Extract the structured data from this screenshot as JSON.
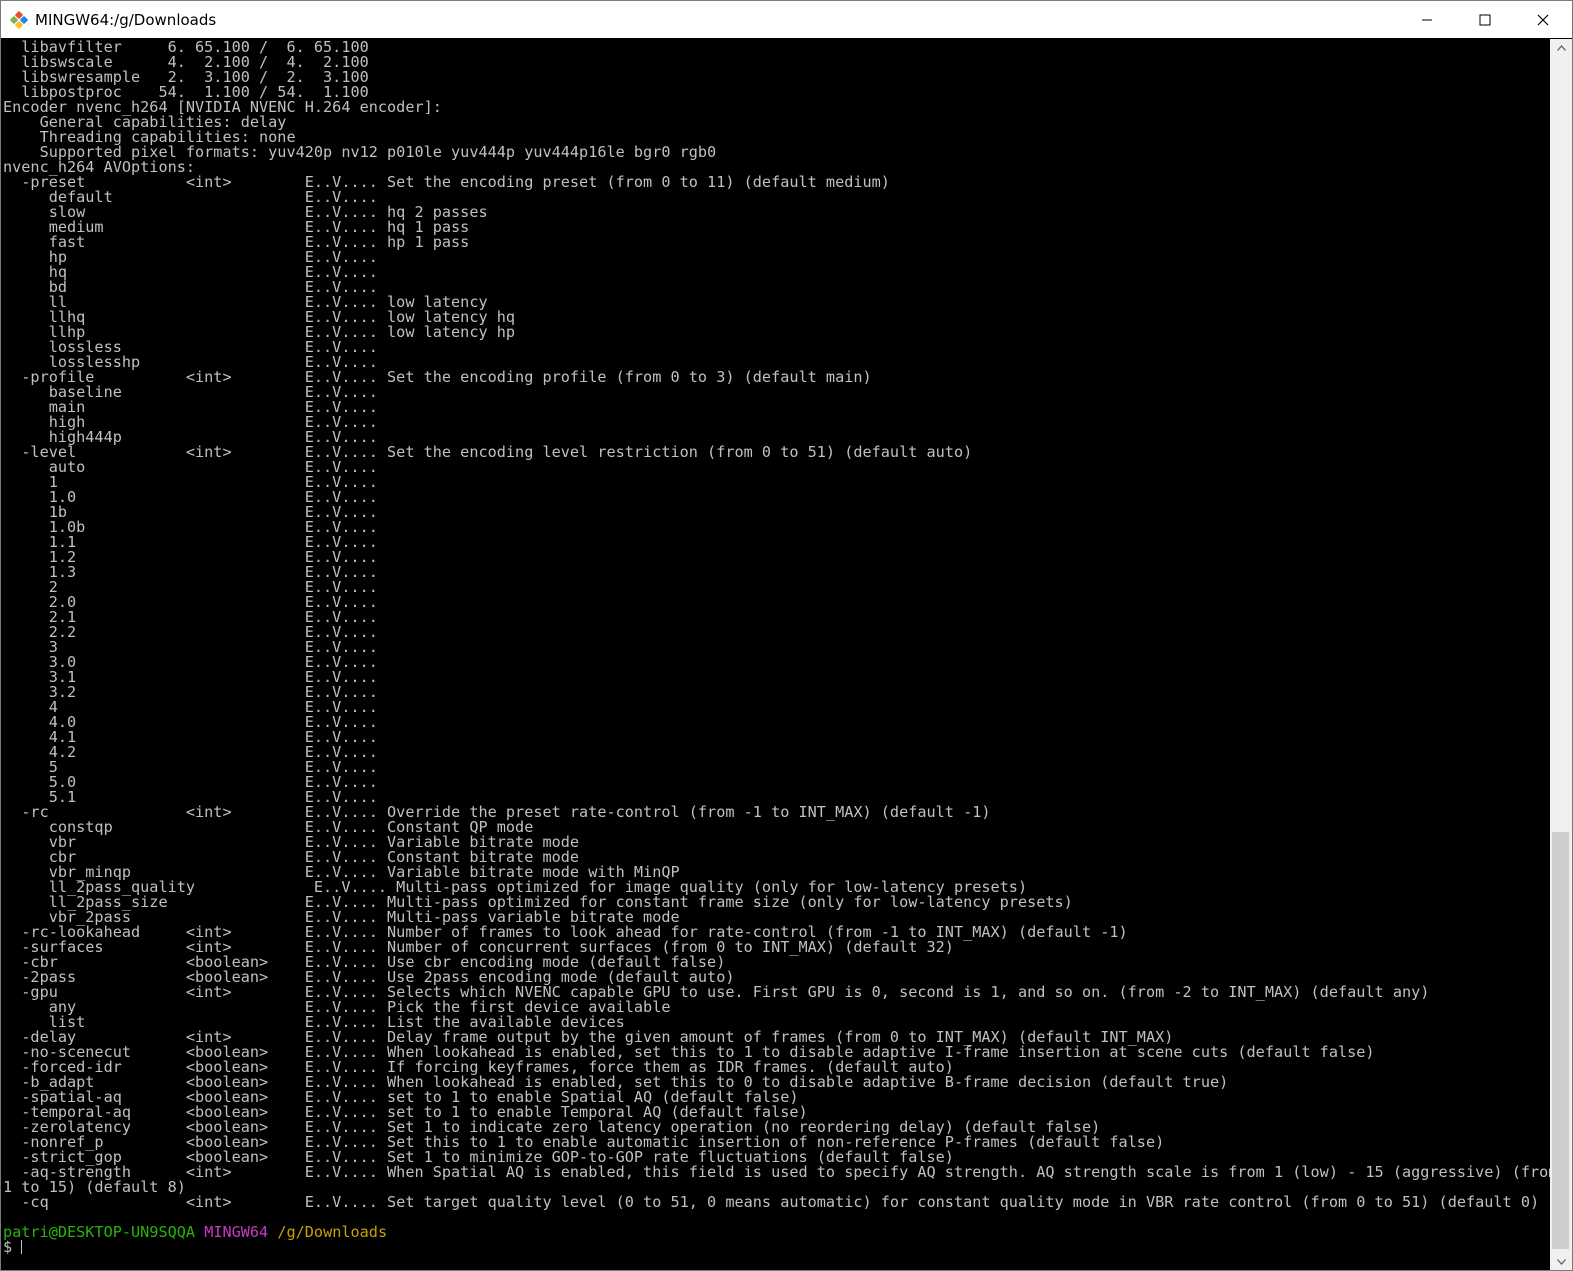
{
  "window": {
    "title": "MINGW64:/g/Downloads",
    "icons": {
      "app": "git-bash-icon",
      "minimize": "minimize-icon",
      "maximize": "maximize-icon",
      "close": "close-icon"
    }
  },
  "terminal": {
    "lines": [
      "  libavfilter     6. 65.100 /  6. 65.100",
      "  libswscale      4.  2.100 /  4.  2.100",
      "  libswresample   2.  3.100 /  2.  3.100",
      "  libpostproc    54.  1.100 / 54.  1.100",
      "Encoder nvenc_h264 [NVIDIA NVENC H.264 encoder]:",
      "    General capabilities: delay",
      "    Threading capabilities: none",
      "    Supported pixel formats: yuv420p nv12 p010le yuv444p yuv444p16le bgr0 rgb0",
      "nvenc_h264 AVOptions:",
      "  -preset           <int>        E..V.... Set the encoding preset (from 0 to 11) (default medium)",
      "     default                     E..V....",
      "     slow                        E..V.... hq 2 passes",
      "     medium                      E..V.... hq 1 pass",
      "     fast                        E..V.... hp 1 pass",
      "     hp                          E..V....",
      "     hq                          E..V....",
      "     bd                          E..V....",
      "     ll                          E..V.... low latency",
      "     llhq                        E..V.... low latency hq",
      "     llhp                        E..V.... low latency hp",
      "     lossless                    E..V....",
      "     losslesshp                  E..V....",
      "  -profile          <int>        E..V.... Set the encoding profile (from 0 to 3) (default main)",
      "     baseline                    E..V....",
      "     main                        E..V....",
      "     high                        E..V....",
      "     high444p                    E..V....",
      "  -level            <int>        E..V.... Set the encoding level restriction (from 0 to 51) (default auto)",
      "     auto                        E..V....",
      "     1                           E..V....",
      "     1.0                         E..V....",
      "     1b                          E..V....",
      "     1.0b                        E..V....",
      "     1.1                         E..V....",
      "     1.2                         E..V....",
      "     1.3                         E..V....",
      "     2                           E..V....",
      "     2.0                         E..V....",
      "     2.1                         E..V....",
      "     2.2                         E..V....",
      "     3                           E..V....",
      "     3.0                         E..V....",
      "     3.1                         E..V....",
      "     3.2                         E..V....",
      "     4                           E..V....",
      "     4.0                         E..V....",
      "     4.1                         E..V....",
      "     4.2                         E..V....",
      "     5                           E..V....",
      "     5.0                         E..V....",
      "     5.1                         E..V....",
      "  -rc               <int>        E..V.... Override the preset rate-control (from -1 to INT_MAX) (default -1)",
      "     constqp                     E..V.... Constant QP mode",
      "     vbr                         E..V.... Variable bitrate mode",
      "     cbr                         E..V.... Constant bitrate mode",
      "     vbr_minqp                   E..V.... Variable bitrate mode with MinQP",
      "     ll_2pass_quality             E..V.... Multi-pass optimized for image quality (only for low-latency presets)",
      "     ll_2pass_size               E..V.... Multi-pass optimized for constant frame size (only for low-latency presets)",
      "     vbr_2pass                   E..V.... Multi-pass variable bitrate mode",
      "  -rc-lookahead     <int>        E..V.... Number of frames to look ahead for rate-control (from -1 to INT_MAX) (default -1)",
      "  -surfaces         <int>        E..V.... Number of concurrent surfaces (from 0 to INT_MAX) (default 32)",
      "  -cbr              <boolean>    E..V.... Use cbr encoding mode (default false)",
      "  -2pass            <boolean>    E..V.... Use 2pass encoding mode (default auto)",
      "  -gpu              <int>        E..V.... Selects which NVENC capable GPU to use. First GPU is 0, second is 1, and so on. (from -2 to INT_MAX) (default any)",
      "     any                         E..V.... Pick the first device available",
      "     list                        E..V.... List the available devices",
      "  -delay            <int>        E..V.... Delay frame output by the given amount of frames (from 0 to INT_MAX) (default INT_MAX)",
      "  -no-scenecut      <boolean>    E..V.... When lookahead is enabled, set this to 1 to disable adaptive I-frame insertion at scene cuts (default false)",
      "  -forced-idr       <boolean>    E..V.... If forcing keyframes, force them as IDR frames. (default auto)",
      "  -b_adapt          <boolean>    E..V.... When lookahead is enabled, set this to 0 to disable adaptive B-frame decision (default true)",
      "  -spatial-aq       <boolean>    E..V.... set to 1 to enable Spatial AQ (default false)",
      "  -temporal-aq      <boolean>    E..V.... set to 1 to enable Temporal AQ (default false)",
      "  -zerolatency      <boolean>    E..V.... Set 1 to indicate zero latency operation (no reordering delay) (default false)",
      "  -nonref_p         <boolean>    E..V.... Set this to 1 to enable automatic insertion of non-reference P-frames (default false)",
      "  -strict_gop       <boolean>    E..V.... Set 1 to minimize GOP-to-GOP rate fluctuations (default false)",
      "  -aq-strength      <int>        E..V.... When Spatial AQ is enabled, this field is used to specify AQ strength. AQ strength scale is from 1 (low) - 15 (aggressive) (from",
      "1 to 15) (default 8)",
      "  -cq               <int>        E..V.... Set target quality level (0 to 51, 0 means automatic) for constant quality mode in VBR rate control (from 0 to 51) (default 0)",
      ""
    ],
    "prompt": {
      "user_host": "patri@DESKTOP-UN9SQQA",
      "system": "MINGW64",
      "path": "/g/Downloads",
      "symbol": "$ "
    }
  },
  "colors": {
    "background": "#000000",
    "text": "#c0c0c0",
    "prompt_user": "#29b40a",
    "prompt_system": "#c43ac4",
    "prompt_path": "#c7a200"
  }
}
